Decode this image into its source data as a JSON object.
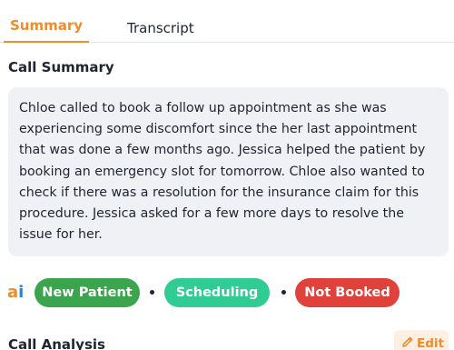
{
  "tabs": [
    {
      "label": "Summary",
      "active": true
    },
    {
      "label": "Transcript",
      "active": false
    }
  ],
  "call_summary": {
    "title": "Call Summary",
    "text": "Chloe called to book a follow up appointment as she was experiencing some discomfort since the her last appointment that was done a few months ago. Jessica helped the patient by booking an emergency slot for tomorrow. Chloe also wanted to check if there was a resolution for the insurance claim for this procedure. Jessica asked for a few more days to resolve the issue for her."
  },
  "tags": [
    {
      "label": "New Patient",
      "color": "#3aa54d"
    },
    {
      "label": "Scheduling",
      "color": "#30cc94"
    },
    {
      "label": "Not Booked",
      "color": "#e0413a"
    }
  ],
  "ai_logo": {
    "letter": "a",
    "letter2": "i",
    "icon": "ai-logo-icon"
  },
  "call_analysis": {
    "title": "Call Analysis",
    "edit_label": "Edit",
    "edit_icon": "pencil-icon"
  },
  "colors": {
    "accent": "#f08c2a",
    "summary_bg": "#f0f1f4"
  }
}
